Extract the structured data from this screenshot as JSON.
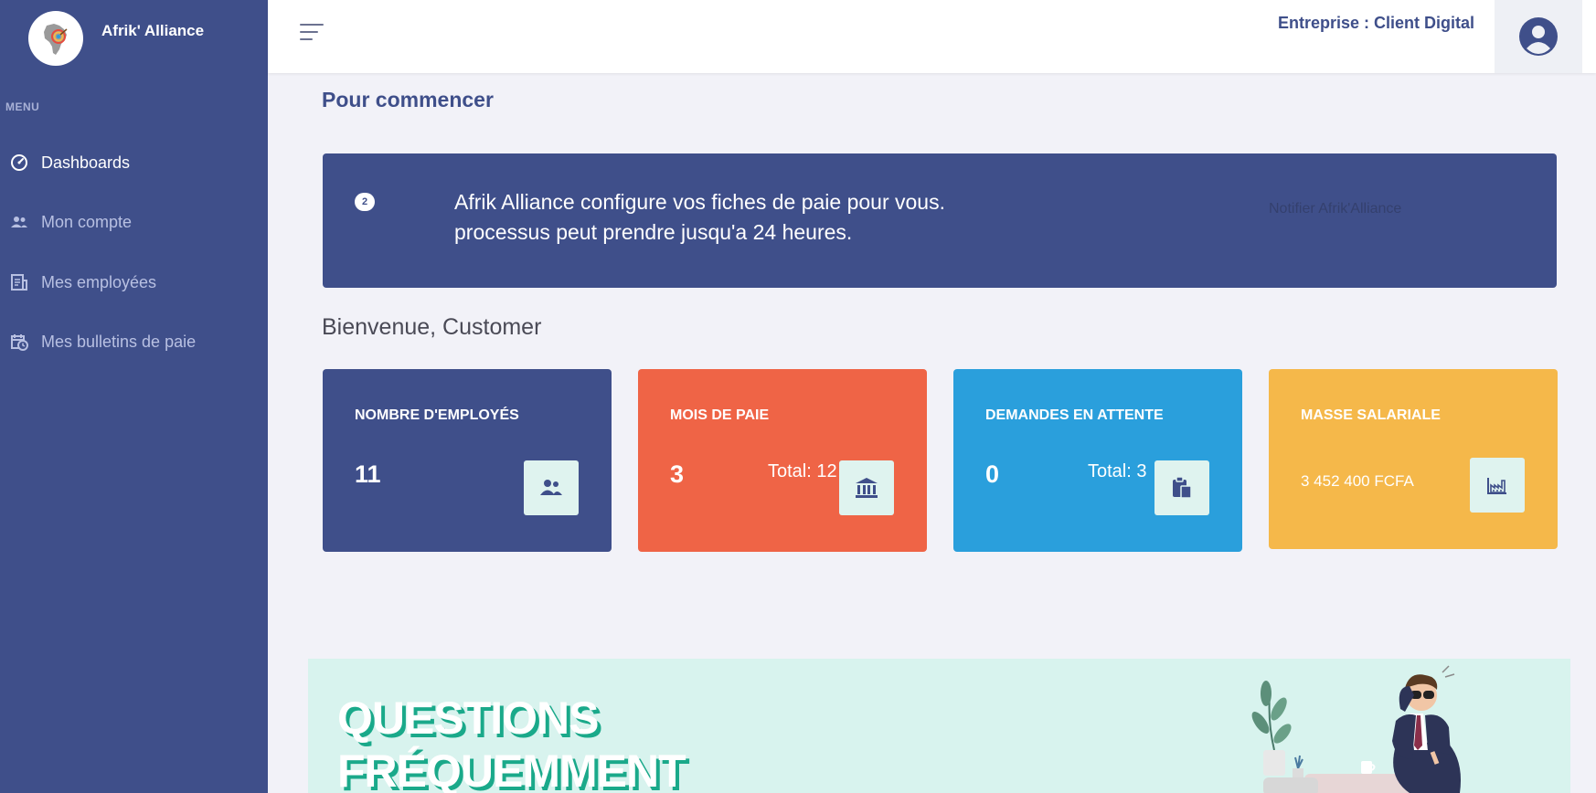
{
  "brand": {
    "name": "Afrik' Alliance"
  },
  "sidebar": {
    "menu_label": "MENU",
    "items": [
      {
        "label": "Dashboards",
        "icon": "gauge-icon",
        "active": true
      },
      {
        "label": "Mon compte",
        "icon": "users-icon",
        "active": false
      },
      {
        "label": "Mes employées",
        "icon": "document-list-icon",
        "active": false
      },
      {
        "label": "Mes bulletins de paie",
        "icon": "calendar-clock-icon",
        "active": false
      }
    ]
  },
  "header": {
    "company": "Entreprise : Client Digital"
  },
  "main": {
    "section_title": "Pour commencer",
    "banner": {
      "step": "2",
      "line1": "Afrik Alliance configure vos fiches de paie pour vous.",
      "line2": "processus peut prendre jusqu'a 24 heures.",
      "notify_label": "Notifier Afrik'Alliance"
    },
    "welcome": "Bienvenue, Customer",
    "cards": [
      {
        "title": "NOMBRE D'EMPLOYÉS",
        "value": "11",
        "total": "",
        "icon": "users-icon",
        "color": "#3f4f8a"
      },
      {
        "title": "MOIS DE PAIE",
        "value": "3",
        "total": "Total: 12",
        "icon": "bank-icon",
        "color": "#ef6446"
      },
      {
        "title": "DEMANDES EN ATTENTE",
        "value": "0",
        "total": "Total: 3",
        "icon": "clipboard-icon",
        "color": "#2a9fdc"
      },
      {
        "title": "MASSE SALARIALE",
        "value": "3 452 400 FCFA",
        "total": "",
        "icon": "factory-chart-icon",
        "color": "#f5b84a"
      }
    ],
    "faq": {
      "title_line1": "QUESTIONS",
      "title_line2": "FRÉQUEMMENT"
    }
  }
}
